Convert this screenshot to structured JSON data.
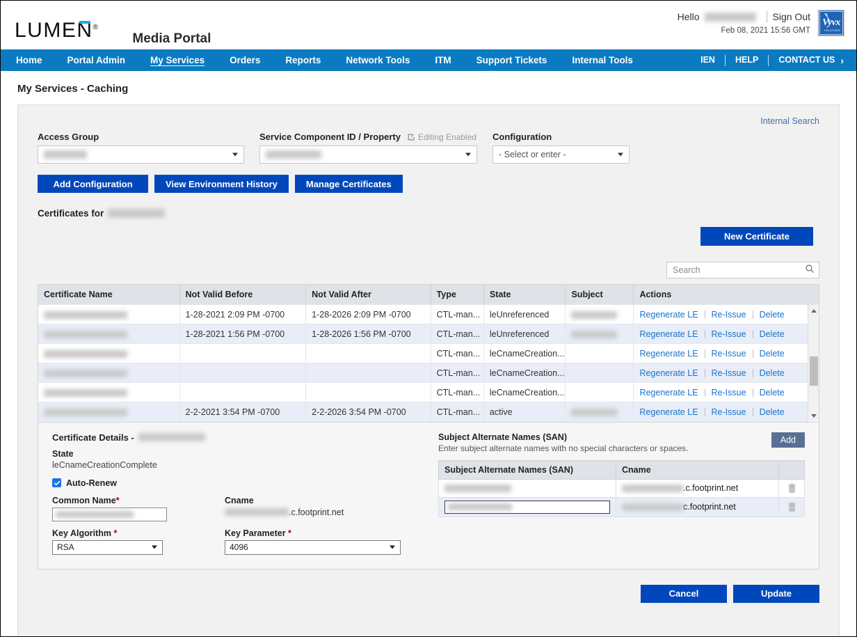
{
  "header": {
    "brand": "LUMEN",
    "brand_reg": "®",
    "portal_title": "Media Portal",
    "hello_label": "Hello",
    "user_name_redacted": "",
    "sign_out": "Sign Out",
    "datetime": "Feb 08, 2021 15:56 GMT",
    "vyvx_logo_text": "Vyvx",
    "vyvx_logo_sub": "SOLUTIONS"
  },
  "nav": {
    "items": [
      {
        "label": "Home",
        "active": false
      },
      {
        "label": "Portal Admin",
        "active": false
      },
      {
        "label": "My Services",
        "active": true
      },
      {
        "label": "Orders",
        "active": false
      },
      {
        "label": "Reports",
        "active": false
      },
      {
        "label": "Network Tools",
        "active": false
      },
      {
        "label": "ITM",
        "active": false
      },
      {
        "label": "Support Tickets",
        "active": false
      },
      {
        "label": "Internal Tools",
        "active": false
      }
    ],
    "right_items": [
      {
        "label": "IEN"
      },
      {
        "label": "HELP"
      },
      {
        "label": "CONTACT US"
      }
    ],
    "chevron": "›"
  },
  "page": {
    "title": "My Services - Caching",
    "internal_search": "Internal Search"
  },
  "filters": {
    "access_group": {
      "label": "Access Group",
      "value_redacted": ""
    },
    "service_component": {
      "label": "Service Component ID / Property",
      "editing_flag": "Editing Enabled",
      "value_redacted": ""
    },
    "configuration": {
      "label": "Configuration",
      "value": "- Select or enter -"
    }
  },
  "actions": {
    "add_configuration": "Add Configuration",
    "view_environment_history": "View Environment History",
    "manage_certificates": "Manage Certificates",
    "new_certificate": "New Certificate"
  },
  "certificates": {
    "heading_prefix": "Certificates for",
    "heading_value_redacted": "",
    "search_placeholder": "Search",
    "search_value": "",
    "columns": [
      "Certificate Name",
      "Not Valid Before",
      "Not Valid After",
      "Type",
      "State",
      "Subject",
      "Actions"
    ],
    "rows": [
      {
        "name_redacted": "",
        "not_valid_before": "1-28-2021 2:09 PM -0700",
        "not_valid_after": "1-28-2026 2:09 PM -0700",
        "type": "CTL-man...",
        "state": "leUnreferenced",
        "subject_redacted": "has",
        "actions": [
          "Regenerate LE",
          "Re-Issue",
          "Delete"
        ]
      },
      {
        "name_redacted": "",
        "not_valid_before": "1-28-2021 1:56 PM -0700",
        "not_valid_after": "1-28-2026 1:56 PM -0700",
        "type": "CTL-man...",
        "state": "leUnreferenced",
        "subject_redacted": "has",
        "actions": [
          "Regenerate LE",
          "Re-Issue",
          "Delete"
        ]
      },
      {
        "name_redacted": "",
        "not_valid_before": "",
        "not_valid_after": "",
        "type": "CTL-man...",
        "state": "leCnameCreation...",
        "subject_redacted": "",
        "actions": [
          "Regenerate LE",
          "Re-Issue",
          "Delete"
        ]
      },
      {
        "name_redacted": "",
        "not_valid_before": "",
        "not_valid_after": "",
        "type": "CTL-man...",
        "state": "leCnameCreation...",
        "subject_redacted": "",
        "actions": [
          "Regenerate LE",
          "Re-Issue",
          "Delete"
        ]
      },
      {
        "name_redacted": "",
        "not_valid_before": "",
        "not_valid_after": "",
        "type": "CTL-man...",
        "state": "leCnameCreation...",
        "subject_redacted": "",
        "actions": [
          "Regenerate LE",
          "Re-Issue",
          "Delete"
        ]
      },
      {
        "name_redacted": "",
        "not_valid_before": "2-2-2021 3:54 PM -0700",
        "not_valid_after": "2-2-2026 3:54 PM -0700",
        "type": "CTL-man...",
        "state": "active",
        "subject_redacted": "has",
        "actions": [
          "Regenerate LE",
          "Re-Issue",
          "Delete"
        ]
      }
    ]
  },
  "details": {
    "title_prefix": "Certificate Details -",
    "title_value_redacted": "",
    "state_label": "State",
    "state_value": "leCnameCreationComplete",
    "auto_renew_label": "Auto-Renew",
    "auto_renew_checked": true,
    "common_name_label": "Common Name",
    "common_name_required": "*",
    "common_name_value_redacted": "",
    "cname_label": "Cname",
    "cname_suffix": ".c.footprint.net",
    "key_algorithm_label": "Key Algorithm",
    "key_algorithm_required": "*",
    "key_algorithm_value": "RSA",
    "key_parameter_label": "Key Parameter",
    "key_parameter_required": "*",
    "key_parameter_value": "4096"
  },
  "san": {
    "title": "Subject Alternate Names (SAN)",
    "subtitle": "Enter subject alternate names with no special characters or spaces.",
    "add_label": "Add",
    "columns": [
      "Subject Alternate Names (SAN)",
      "Cname"
    ],
    "rows": [
      {
        "san_redacted": "",
        "cname_suffix": ".c.footprint.net",
        "editable": false
      },
      {
        "san_redacted": "",
        "cname_suffix": "c.footprint.net",
        "editable": true
      }
    ]
  },
  "footer": {
    "cancel": "Cancel",
    "update": "Update"
  },
  "colors": {
    "nav_blue": "#0b7bc1",
    "button_blue": "#0047bb",
    "link_blue": "#1a73c8",
    "accent_cyan": "#16b1e8",
    "add_button": "#5a6f95"
  }
}
